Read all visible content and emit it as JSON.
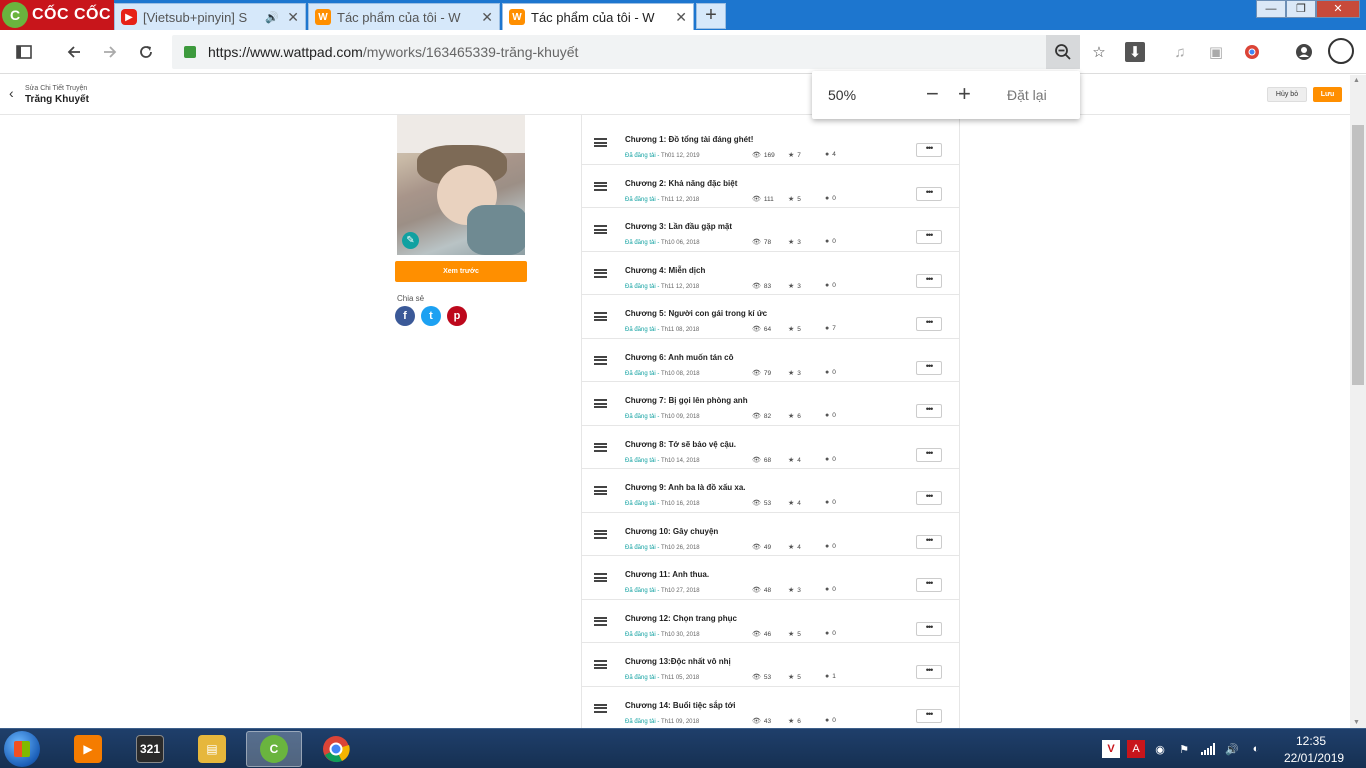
{
  "browser": {
    "logo_text": "CỐC CỐC",
    "tabs": [
      {
        "title": "[Vietsub+pinyin] S",
        "icon": "youtube-icon",
        "close": "✕",
        "speaker": "🔊"
      },
      {
        "title": "Tác phẩm của tôi - W",
        "icon": "wattpad-icon",
        "close": "✕"
      },
      {
        "title": "Tác phẩm của tôi - W",
        "icon": "wattpad-icon",
        "close": "✕"
      }
    ],
    "new_tab": "+",
    "url_host": "https://www.wattpad.com",
    "url_path": "/myworks/163465339-trăng-khuyết",
    "zoom": {
      "value": "50%",
      "minus": "−",
      "plus": "+",
      "reset": "Đặt lại"
    }
  },
  "page": {
    "breadcrumb_small": "Sửa Chi Tiết Truyện",
    "story_title": "Trăng Khuyết",
    "cancel_label": "Hủy bỏ",
    "save_label": "Lưu",
    "preview_label": "Xem trước",
    "share_label": "Chia sẻ",
    "share_icons": [
      "f",
      "t",
      "p"
    ],
    "status_label": "Đã đăng tải",
    "more_label": "•••"
  },
  "chapters": [
    {
      "title": "Chương 1: Đồ tổng tài đáng ghét!",
      "date": "Th01 12, 2019",
      "views": "169",
      "votes": "7",
      "comments": "4"
    },
    {
      "title": "Chương 2: Khả năng đặc biệt",
      "date": "Th11 12, 2018",
      "views": "111",
      "votes": "5",
      "comments": "0"
    },
    {
      "title": "Chương 3: Lần đầu gặp mặt",
      "date": "Th10 06, 2018",
      "views": "78",
      "votes": "3",
      "comments": "0"
    },
    {
      "title": "Chương 4: Miễn dịch",
      "date": "Th11 12, 2018",
      "views": "83",
      "votes": "3",
      "comments": "0"
    },
    {
      "title": "Chương 5: Người con gái trong kí ức",
      "date": "Th11 08, 2018",
      "views": "64",
      "votes": "5",
      "comments": "7"
    },
    {
      "title": "Chương 6: Anh muốn tán cô",
      "date": "Th10 08, 2018",
      "views": "79",
      "votes": "3",
      "comments": "0"
    },
    {
      "title": "Chương 7: Bị gọi lên phòng anh",
      "date": "Th10 09, 2018",
      "views": "82",
      "votes": "6",
      "comments": "0"
    },
    {
      "title": "Chương 8: Tớ sẽ bảo vệ cậu.",
      "date": "Th10 14, 2018",
      "views": "68",
      "votes": "4",
      "comments": "0"
    },
    {
      "title": "Chương 9: Anh ba là đồ xấu xa.",
      "date": "Th10 16, 2018",
      "views": "53",
      "votes": "4",
      "comments": "0"
    },
    {
      "title": "Chương 10: Gây chuyện",
      "date": "Th10 26, 2018",
      "views": "49",
      "votes": "4",
      "comments": "0"
    },
    {
      "title": "Chương 11: Anh thua.",
      "date": "Th10 27, 2018",
      "views": "48",
      "votes": "3",
      "comments": "0"
    },
    {
      "title": "Chương 12: Chọn trang phục",
      "date": "Th10 30, 2018",
      "views": "46",
      "votes": "5",
      "comments": "0"
    },
    {
      "title": "Chương 13:Độc nhất vô nhị",
      "date": "Th11 05, 2018",
      "views": "53",
      "votes": "5",
      "comments": "1"
    },
    {
      "title": "Chương 14: Buổi tiệc sắp tới",
      "date": "Th11 09, 2018",
      "views": "43",
      "votes": "6",
      "comments": "0"
    }
  ],
  "taskbar": {
    "clock_time": "12:35",
    "clock_date": "22/01/2019",
    "app_321": "321"
  },
  "colors": {
    "accent": "#ff8f00",
    "teal": "#11a1a1"
  }
}
